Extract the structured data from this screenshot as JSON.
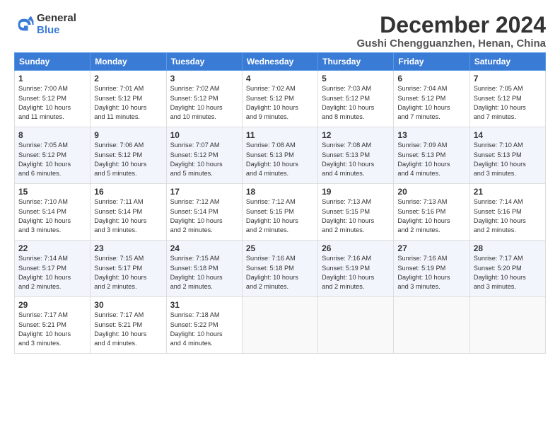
{
  "logo": {
    "general": "General",
    "blue": "Blue"
  },
  "title": "December 2024",
  "location": "Gushi Chengguanzhen, Henan, China",
  "weekdays": [
    "Sunday",
    "Monday",
    "Tuesday",
    "Wednesday",
    "Thursday",
    "Friday",
    "Saturday"
  ],
  "weeks": [
    [
      {
        "day": "1",
        "info": "Sunrise: 7:00 AM\nSunset: 5:12 PM\nDaylight: 10 hours\nand 11 minutes."
      },
      {
        "day": "2",
        "info": "Sunrise: 7:01 AM\nSunset: 5:12 PM\nDaylight: 10 hours\nand 11 minutes."
      },
      {
        "day": "3",
        "info": "Sunrise: 7:02 AM\nSunset: 5:12 PM\nDaylight: 10 hours\nand 10 minutes."
      },
      {
        "day": "4",
        "info": "Sunrise: 7:02 AM\nSunset: 5:12 PM\nDaylight: 10 hours\nand 9 minutes."
      },
      {
        "day": "5",
        "info": "Sunrise: 7:03 AM\nSunset: 5:12 PM\nDaylight: 10 hours\nand 8 minutes."
      },
      {
        "day": "6",
        "info": "Sunrise: 7:04 AM\nSunset: 5:12 PM\nDaylight: 10 hours\nand 7 minutes."
      },
      {
        "day": "7",
        "info": "Sunrise: 7:05 AM\nSunset: 5:12 PM\nDaylight: 10 hours\nand 7 minutes."
      }
    ],
    [
      {
        "day": "8",
        "info": "Sunrise: 7:05 AM\nSunset: 5:12 PM\nDaylight: 10 hours\nand 6 minutes."
      },
      {
        "day": "9",
        "info": "Sunrise: 7:06 AM\nSunset: 5:12 PM\nDaylight: 10 hours\nand 5 minutes."
      },
      {
        "day": "10",
        "info": "Sunrise: 7:07 AM\nSunset: 5:12 PM\nDaylight: 10 hours\nand 5 minutes."
      },
      {
        "day": "11",
        "info": "Sunrise: 7:08 AM\nSunset: 5:13 PM\nDaylight: 10 hours\nand 4 minutes."
      },
      {
        "day": "12",
        "info": "Sunrise: 7:08 AM\nSunset: 5:13 PM\nDaylight: 10 hours\nand 4 minutes."
      },
      {
        "day": "13",
        "info": "Sunrise: 7:09 AM\nSunset: 5:13 PM\nDaylight: 10 hours\nand 4 minutes."
      },
      {
        "day": "14",
        "info": "Sunrise: 7:10 AM\nSunset: 5:13 PM\nDaylight: 10 hours\nand 3 minutes."
      }
    ],
    [
      {
        "day": "15",
        "info": "Sunrise: 7:10 AM\nSunset: 5:14 PM\nDaylight: 10 hours\nand 3 minutes."
      },
      {
        "day": "16",
        "info": "Sunrise: 7:11 AM\nSunset: 5:14 PM\nDaylight: 10 hours\nand 3 minutes."
      },
      {
        "day": "17",
        "info": "Sunrise: 7:12 AM\nSunset: 5:14 PM\nDaylight: 10 hours\nand 2 minutes."
      },
      {
        "day": "18",
        "info": "Sunrise: 7:12 AM\nSunset: 5:15 PM\nDaylight: 10 hours\nand 2 minutes."
      },
      {
        "day": "19",
        "info": "Sunrise: 7:13 AM\nSunset: 5:15 PM\nDaylight: 10 hours\nand 2 minutes."
      },
      {
        "day": "20",
        "info": "Sunrise: 7:13 AM\nSunset: 5:16 PM\nDaylight: 10 hours\nand 2 minutes."
      },
      {
        "day": "21",
        "info": "Sunrise: 7:14 AM\nSunset: 5:16 PM\nDaylight: 10 hours\nand 2 minutes."
      }
    ],
    [
      {
        "day": "22",
        "info": "Sunrise: 7:14 AM\nSunset: 5:17 PM\nDaylight: 10 hours\nand 2 minutes."
      },
      {
        "day": "23",
        "info": "Sunrise: 7:15 AM\nSunset: 5:17 PM\nDaylight: 10 hours\nand 2 minutes."
      },
      {
        "day": "24",
        "info": "Sunrise: 7:15 AM\nSunset: 5:18 PM\nDaylight: 10 hours\nand 2 minutes."
      },
      {
        "day": "25",
        "info": "Sunrise: 7:16 AM\nSunset: 5:18 PM\nDaylight: 10 hours\nand 2 minutes."
      },
      {
        "day": "26",
        "info": "Sunrise: 7:16 AM\nSunset: 5:19 PM\nDaylight: 10 hours\nand 2 minutes."
      },
      {
        "day": "27",
        "info": "Sunrise: 7:16 AM\nSunset: 5:19 PM\nDaylight: 10 hours\nand 3 minutes."
      },
      {
        "day": "28",
        "info": "Sunrise: 7:17 AM\nSunset: 5:20 PM\nDaylight: 10 hours\nand 3 minutes."
      }
    ],
    [
      {
        "day": "29",
        "info": "Sunrise: 7:17 AM\nSunset: 5:21 PM\nDaylight: 10 hours\nand 3 minutes."
      },
      {
        "day": "30",
        "info": "Sunrise: 7:17 AM\nSunset: 5:21 PM\nDaylight: 10 hours\nand 4 minutes."
      },
      {
        "day": "31",
        "info": "Sunrise: 7:18 AM\nSunset: 5:22 PM\nDaylight: 10 hours\nand 4 minutes."
      },
      null,
      null,
      null,
      null
    ]
  ]
}
